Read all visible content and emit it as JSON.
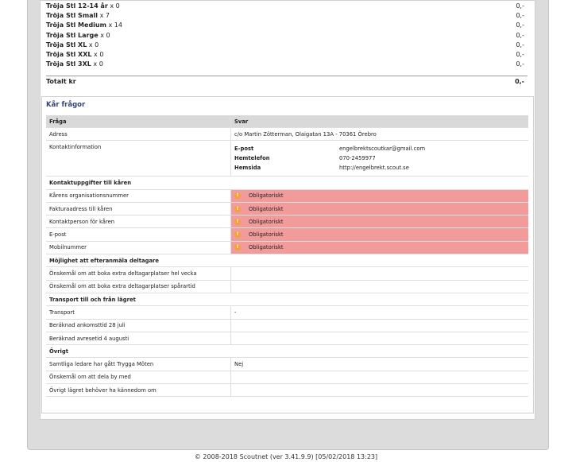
{
  "summary": {
    "items": [
      {
        "name": "Tröja Stl 12-14 år",
        "count": " x 0",
        "amount": "0,-"
      },
      {
        "name": "Tröja Stl Small",
        "count": " x 7",
        "amount": "0,-"
      },
      {
        "name": "Tröja Stl Medium",
        "count": " x 14",
        "amount": "0,-"
      },
      {
        "name": "Tröja Stl Large",
        "count": " x 0",
        "amount": "0,-"
      },
      {
        "name": "Tröja Stl XL",
        "count": " x 0",
        "amount": "0,-"
      },
      {
        "name": "Tröja Stl XXL",
        "count": " x 0",
        "amount": "0,-"
      },
      {
        "name": "Tröja Stl 3XL",
        "count": " x 0",
        "amount": "0,-"
      }
    ],
    "total_label": "Totalt kr",
    "total_amount": "0,-"
  },
  "questions": {
    "title": "Kår frågor",
    "col_question": "Fråga",
    "col_answer": "Svar",
    "address_label": "Adress",
    "address_value": "c/o Martin Zötterman, Olaigatan 13A - 70361 Örebro",
    "contact_label": "Kontaktinformation",
    "contact": {
      "email_label": "E-post",
      "email_value": "engelbrektscoutkar@gmail.com",
      "phone_label": "Hemtelefon",
      "phone_value": "070-2459977",
      "web_label": "Hemsida",
      "web_value": "http://engelbrekt.scout.se"
    },
    "section_contact": "Kontaktuppgifter till kåren",
    "org_number": "Kårens organisationsnummer",
    "invoice_address": "Fakturaadress till kåren",
    "contact_person": "Kontaktperson för kåren",
    "email": "E-post",
    "mobile": "Mobilnummer",
    "required_text": "Obligatoriskt",
    "required_icon": "!",
    "section_late": "Möjlighet att efteranmäla deltagare",
    "extra_week": "Önskemål om att boka extra deltagarplatser hel vecka",
    "extra_scout": "Önskemål om att boka extra deltagarplatser spårartid",
    "section_transport": "Transport till och från lägret",
    "transport": "Transport",
    "transport_value": "-",
    "arrival": "Beräknad ankomsttid 28 juli",
    "departure": "Beräknad avresetid 4 augusti",
    "section_other": "Övrigt",
    "trygga": "Samtliga ledare har gått Trygga Möten",
    "trygga_value": "Nej",
    "share_village": "Önskemål om att dela by med",
    "camp_know": "Övrigt lägret behöver ha kännedom om"
  },
  "footer": "© 2008-2018 Scoutnet (ver 3.41.9.9) [05/02/2018 13:23]"
}
